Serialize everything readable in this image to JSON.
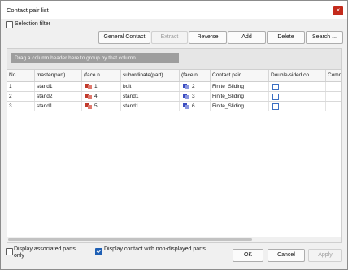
{
  "window": {
    "title": "Contact pair list"
  },
  "filter": {
    "selection_filter_label": "Selection filter",
    "selection_filter_checked": false
  },
  "toolbar": {
    "general_contact": "General Contact",
    "extract": "Extract",
    "reverse": "Reverse",
    "add": "Add",
    "delete": "Delete",
    "search": "Search ..."
  },
  "grid": {
    "group_hint": "Drag a column header here to group by that column.",
    "columns": [
      "No",
      "master(part)",
      "(face n...",
      "subordinate(part)",
      "(face n...",
      "Contact pair",
      "Double-sided co...",
      "Comm"
    ],
    "rows": [
      {
        "no": "1",
        "master": "stand1",
        "master_face": "1",
        "sub": "bolt",
        "sub_face": "2",
        "pair": "Finite_Sliding",
        "double_sided": false
      },
      {
        "no": "2",
        "master": "stand2",
        "master_face": "4",
        "sub": "stand1",
        "sub_face": "3",
        "pair": "Finite_Sliding",
        "double_sided": false
      },
      {
        "no": "3",
        "master": "stand1",
        "master_face": "5",
        "sub": "stand1",
        "sub_face": "6",
        "pair": "Finite_Sliding",
        "double_sided": false
      }
    ]
  },
  "footer": {
    "display_associated_label": "Display associated parts only",
    "display_associated_checked": false,
    "display_contact_label": "Display contact with non-displayed parts",
    "display_contact_checked": true,
    "ok": "OK",
    "cancel": "Cancel",
    "apply": "Apply"
  },
  "colors": {
    "close_button": "#c42b1c",
    "checkbox_accent": "#1e5fb4",
    "master_face_icon": "#c0392b",
    "sub_face_icon": "#3b4cc0"
  },
  "icons": {
    "close": "close-icon",
    "master_face": "master-face-icon",
    "sub_face": "subordinate-face-icon"
  }
}
